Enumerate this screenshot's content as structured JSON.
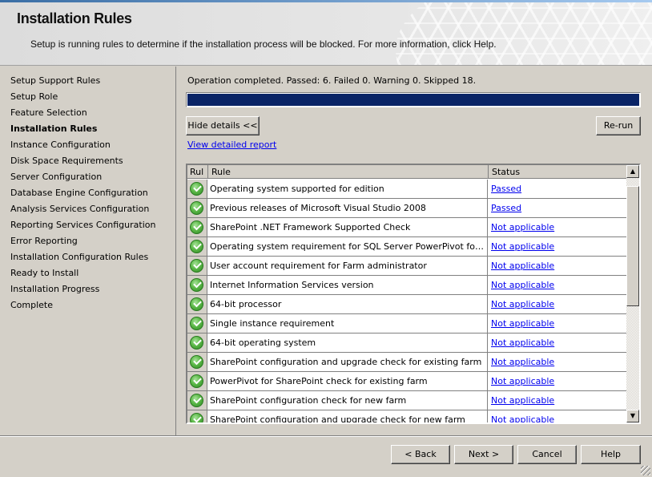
{
  "header": {
    "title": "Installation Rules",
    "subtitle": "Setup is running rules to determine if the installation process will be blocked. For more information, click Help."
  },
  "sidebar": {
    "items": [
      {
        "label": "Setup Support Rules",
        "active": false
      },
      {
        "label": "Setup Role",
        "active": false
      },
      {
        "label": "Feature Selection",
        "active": false
      },
      {
        "label": "Installation Rules",
        "active": true
      },
      {
        "label": "Instance Configuration",
        "active": false
      },
      {
        "label": "Disk Space Requirements",
        "active": false
      },
      {
        "label": "Server Configuration",
        "active": false
      },
      {
        "label": "Database Engine Configuration",
        "active": false
      },
      {
        "label": "Analysis Services Configuration",
        "active": false
      },
      {
        "label": "Reporting Services Configuration",
        "active": false
      },
      {
        "label": "Error Reporting",
        "active": false
      },
      {
        "label": "Installation Configuration Rules",
        "active": false
      },
      {
        "label": "Ready to Install",
        "active": false
      },
      {
        "label": "Installation Progress",
        "active": false
      },
      {
        "label": "Complete",
        "active": false
      }
    ]
  },
  "main": {
    "operation_status": "Operation completed. Passed: 6.   Failed 0.   Warning 0.   Skipped 18.",
    "progress_percent": 100,
    "progress_color": "#0a2466",
    "hide_details_label": "Hide details <<",
    "rerun_label": "Re-run",
    "report_link": "View detailed report",
    "grid": {
      "columns": [
        "Rul",
        "Rule",
        "Status"
      ],
      "rows": [
        {
          "icon": "check-icon",
          "rule": "Operating system supported for edition",
          "status": "Passed"
        },
        {
          "icon": "check-icon",
          "rule": "Previous releases of Microsoft Visual Studio 2008",
          "status": "Passed"
        },
        {
          "icon": "check-icon",
          "rule": "SharePoint .NET Framework Supported Check",
          "status": "Not applicable"
        },
        {
          "icon": "check-icon",
          "rule": "Operating system requirement for SQL Server PowerPivot for SharePoint",
          "status": "Not applicable"
        },
        {
          "icon": "check-icon",
          "rule": "User account requirement for Farm administrator",
          "status": "Not applicable"
        },
        {
          "icon": "check-icon",
          "rule": "Internet Information Services version",
          "status": "Not applicable"
        },
        {
          "icon": "check-icon",
          "rule": "64-bit processor",
          "status": "Not applicable"
        },
        {
          "icon": "check-icon",
          "rule": "Single instance requirement",
          "status": "Not applicable"
        },
        {
          "icon": "check-icon",
          "rule": "64-bit operating system",
          "status": "Not applicable"
        },
        {
          "icon": "check-icon",
          "rule": "SharePoint configuration and upgrade check for existing farm",
          "status": "Not applicable"
        },
        {
          "icon": "check-icon",
          "rule": "PowerPivot for SharePoint check for existing farm",
          "status": "Not applicable"
        },
        {
          "icon": "check-icon",
          "rule": "SharePoint configuration check for new farm",
          "status": "Not applicable"
        },
        {
          "icon": "check-icon",
          "rule": "SharePoint configuration and upgrade check for new farm",
          "status": "Not applicable"
        }
      ]
    }
  },
  "footer": {
    "back_label": "< Back",
    "next_label": "Next >",
    "cancel_label": "Cancel",
    "help_label": "Help"
  }
}
